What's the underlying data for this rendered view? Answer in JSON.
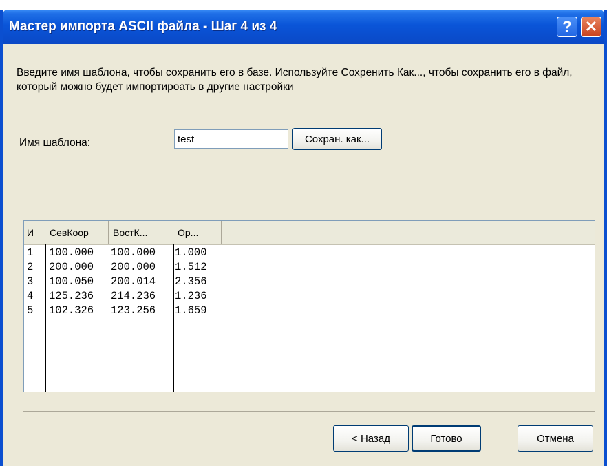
{
  "window": {
    "title": "Мастер импорта ASCII файла  - Шаг 4 из 4",
    "help_glyph": "?",
    "close_glyph": "✕"
  },
  "description": "Введите имя шаблона, чтобы сохранить его в базе. Используйте Сохренить Как..., чтобы сохранить его в файл, который можно будет импортироать в другие настройки",
  "template": {
    "label": "Имя шаблона:",
    "value": "test",
    "save_as_label": "Сохран. как..."
  },
  "grid": {
    "columns": [
      "И",
      "СевКоор",
      "ВостК...",
      "Ор..."
    ],
    "rows": [
      [
        "1",
        "100.000",
        "100.000",
        "1.000"
      ],
      [
        "2",
        "200.000",
        "200.000",
        "1.512"
      ],
      [
        "3",
        "100.050",
        "200.014",
        "2.356"
      ],
      [
        "4",
        "125.236",
        "214.236",
        "1.236"
      ],
      [
        "5",
        "102.326",
        "123.256",
        "1.659"
      ]
    ]
  },
  "buttons": {
    "back": "< Назад",
    "done": "Готово",
    "cancel": "Отмена"
  }
}
